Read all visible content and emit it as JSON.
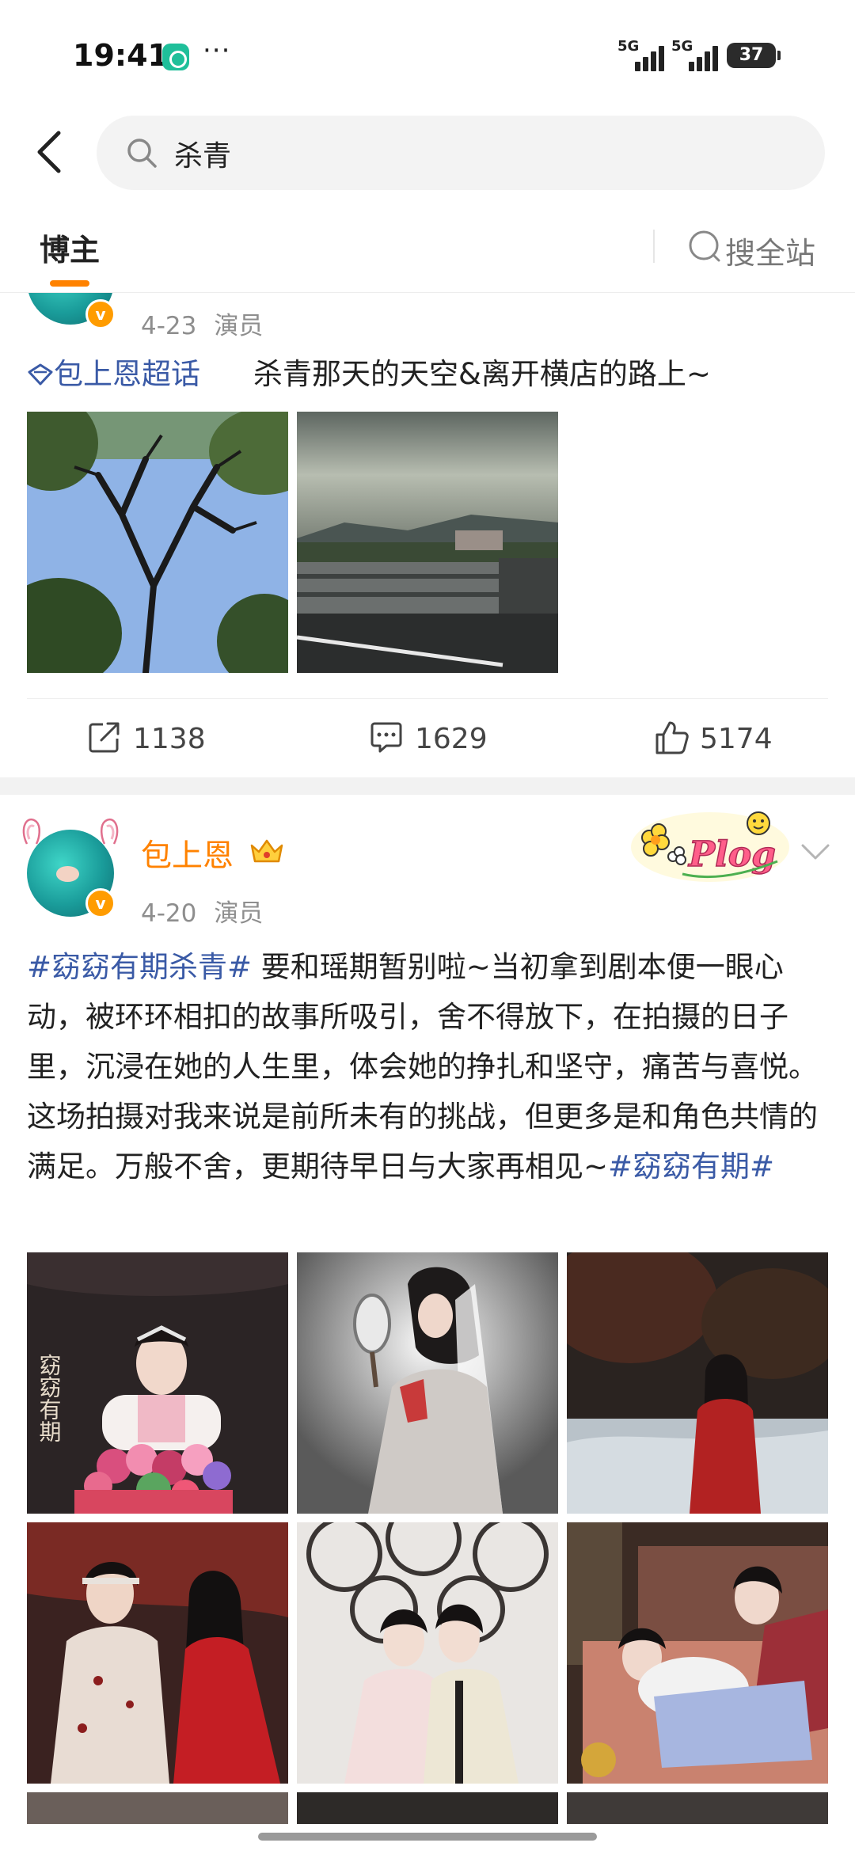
{
  "status_bar": {
    "time": "19:41",
    "net1": "5G",
    "net2": "5G",
    "battery": "37"
  },
  "search": {
    "query": "杀青"
  },
  "tabs": {
    "bozhu": "博主",
    "search_all": "搜全站"
  },
  "posts": [
    {
      "date": "4-23",
      "role": "演员",
      "supertopic": "包上恩超话",
      "text": "杀青那天的天空&离开横店的路上~",
      "reposts": "1138",
      "comments": "1629",
      "likes": "5174"
    },
    {
      "nickname": "包上恩",
      "date": "4-20",
      "role": "演员",
      "topic_start": "#窈窈有期杀青#",
      "text": " 要和瑶期暂别啦~当初拿到剧本便一眼心动，被环环相扣的故事所吸引，舍不得放下，在拍摄的日子里，沉浸在她的人生里，体会她的挣扎和坚守，痛苦与喜悦。这场拍摄对我来说是前所未有的挑战，但更多是和角色共情的满足。万般不舍，更期待早日与大家再相见~",
      "topic_end": "#窈窈有期#",
      "poster_title": "窈窈有期",
      "plog_label": "Plog"
    }
  ],
  "colors": {
    "accent": "#ff8200",
    "link": "#3a5aa6",
    "meta": "#8e8e8e"
  }
}
